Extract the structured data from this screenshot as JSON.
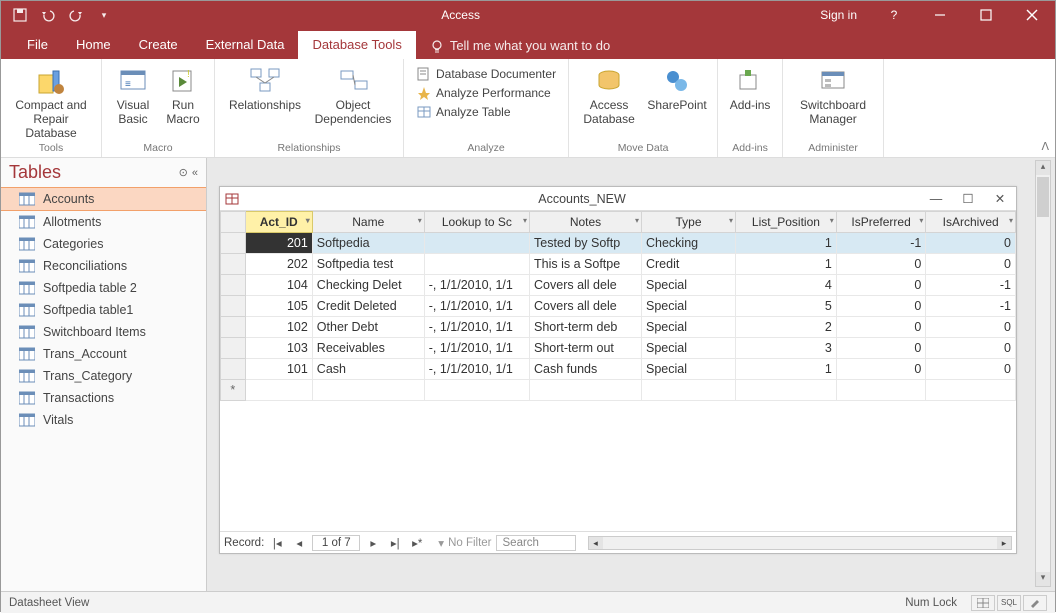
{
  "titlebar": {
    "app": "Access",
    "signin": "Sign in"
  },
  "tabs": [
    "File",
    "Home",
    "Create",
    "External Data",
    "Database Tools"
  ],
  "active_tab": 4,
  "tell_me": "Tell me what you want to do",
  "ribbon": {
    "groups": {
      "tools": {
        "label": "Tools",
        "compact": "Compact and Repair Database"
      },
      "macro": {
        "label": "Macro",
        "vb": "Visual Basic",
        "run": "Run Macro"
      },
      "rel": {
        "label": "Relationships",
        "rel": "Relationships",
        "dep": "Object Dependencies"
      },
      "analyze": {
        "label": "Analyze",
        "doc": "Database Documenter",
        "perf": "Analyze Performance",
        "tbl": "Analyze Table"
      },
      "move": {
        "label": "Move Data",
        "access": "Access Database",
        "sp": "SharePoint"
      },
      "addins": {
        "label": "Add-ins",
        "add": "Add-ins"
      },
      "admin": {
        "label": "Administer",
        "sw": "Switchboard Manager"
      }
    }
  },
  "nav": {
    "header": "Tables",
    "items": [
      "Accounts",
      "Allotments",
      "Categories",
      "Reconciliations",
      "Softpedia table 2",
      "Softpedia table1",
      "Switchboard Items",
      "Trans_Account",
      "Trans_Category",
      "Transactions",
      "Vitals"
    ],
    "selected": 0
  },
  "subwindow": {
    "title": "Accounts_NEW"
  },
  "columns": [
    "Act_ID",
    "Name",
    "Lookup to Sc",
    "Notes",
    "Type",
    "List_Position",
    "IsPreferred",
    "IsArchived"
  ],
  "rows": [
    {
      "id": "201",
      "name": "Softpedia",
      "lookup": "",
      "notes": "Tested by Softp",
      "type": "Checking",
      "pos": "1",
      "pref": "-1",
      "arch": "0"
    },
    {
      "id": "202",
      "name": "Softpedia test",
      "lookup": "",
      "notes": "This is a Softpe",
      "type": "Credit",
      "pos": "1",
      "pref": "0",
      "arch": "0"
    },
    {
      "id": "104",
      "name": "Checking Delet",
      "lookup": "-, 1/1/2010, 1/1",
      "notes": "Covers all dele",
      "type": "Special",
      "pos": "4",
      "pref": "0",
      "arch": "-1"
    },
    {
      "id": "105",
      "name": "Credit Deleted",
      "lookup": "-, 1/1/2010, 1/1",
      "notes": "Covers all dele",
      "type": "Special",
      "pos": "5",
      "pref": "0",
      "arch": "-1"
    },
    {
      "id": "102",
      "name": "Other Debt",
      "lookup": "-, 1/1/2010, 1/1",
      "notes": "Short-term deb",
      "type": "Special",
      "pos": "2",
      "pref": "0",
      "arch": "0"
    },
    {
      "id": "103",
      "name": "Receivables",
      "lookup": "-, 1/1/2010, 1/1",
      "notes": "Short-term out",
      "type": "Special",
      "pos": "3",
      "pref": "0",
      "arch": "0"
    },
    {
      "id": "101",
      "name": "Cash",
      "lookup": "-, 1/1/2010, 1/1",
      "notes": "Cash funds",
      "type": "Special",
      "pos": "1",
      "pref": "0",
      "arch": "0"
    }
  ],
  "recnav": {
    "label": "Record:",
    "pos": "1 of 7",
    "nofilter": "No Filter",
    "search": "Search"
  },
  "status": {
    "view": "Datasheet View",
    "numlock": "Num Lock"
  }
}
